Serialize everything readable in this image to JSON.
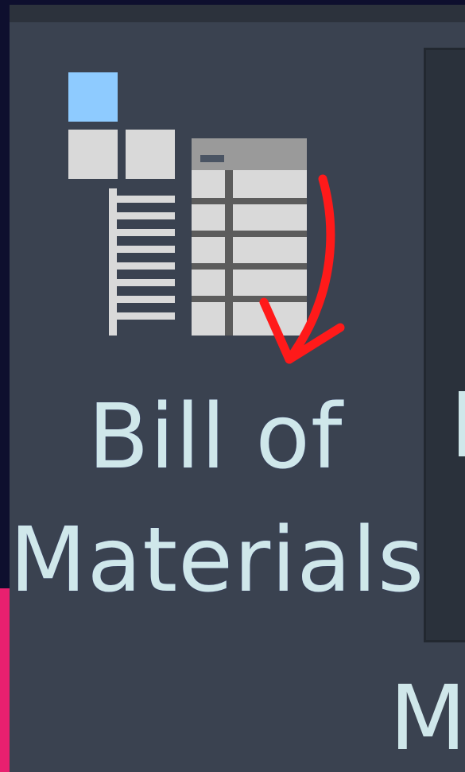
{
  "ribbon": {
    "bill_of_materials": {
      "label_line1": "Bill of",
      "label_line2": "Materials",
      "icon": "bill-of-materials-icon"
    },
    "next_button": {
      "visible_char": "I"
    },
    "next_label": {
      "visible_char": "M"
    }
  },
  "annotation": {
    "icon": "red-arrow-icon",
    "color": "#ff1a1a"
  },
  "colors": {
    "background": "#3a4250",
    "panel": "#2a313b",
    "icon_light": "#d9d9d9",
    "icon_accent": "#8ecbff",
    "icon_grid_header": "#9a9a9a",
    "left_accent": "#e8206f"
  }
}
